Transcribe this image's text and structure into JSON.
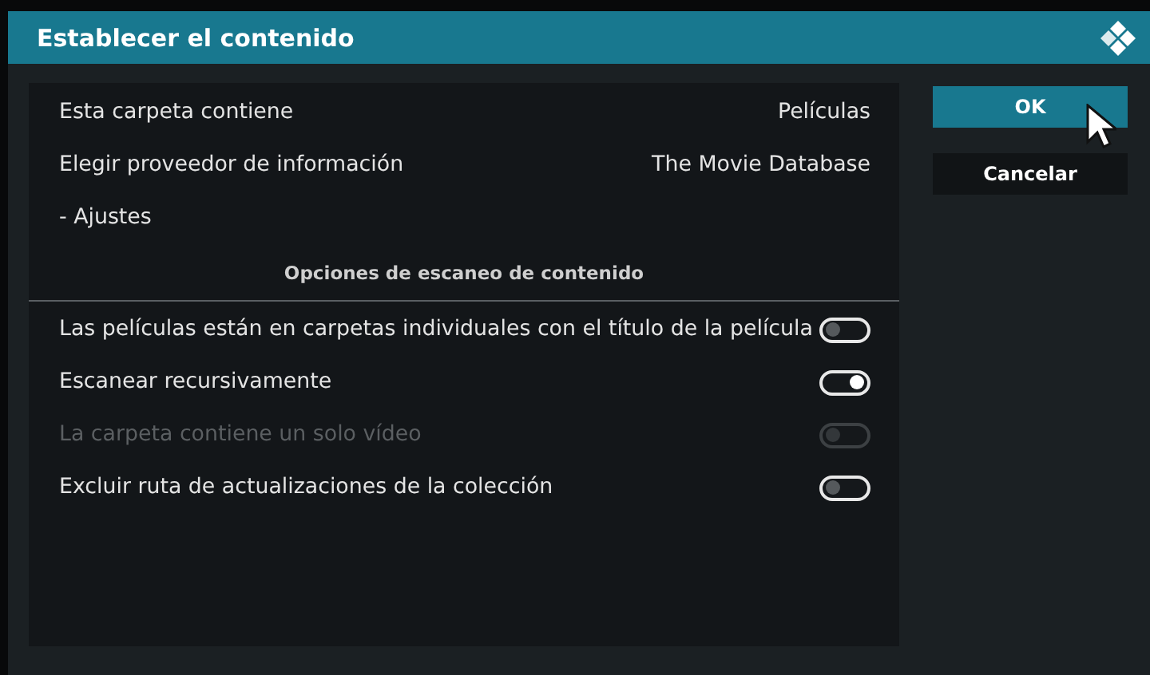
{
  "window": {
    "title": "Establecer el contenido"
  },
  "settings": [
    {
      "kind": "value",
      "label": "Esta carpeta contiene",
      "value": "Películas"
    },
    {
      "kind": "value",
      "label": "Elegir proveedor de información",
      "value": "The Movie Database"
    },
    {
      "kind": "action",
      "label": "- Ajustes"
    },
    {
      "kind": "header",
      "label": "Opciones de escaneo de contenido"
    },
    {
      "kind": "toggle",
      "label": "Las películas están en carpetas individuales con el título de la película",
      "on": false,
      "disabled": false
    },
    {
      "kind": "toggle",
      "label": "Escanear recursivamente",
      "on": true,
      "disabled": false
    },
    {
      "kind": "toggle",
      "label": "La carpeta contiene un solo vídeo",
      "on": false,
      "disabled": true
    },
    {
      "kind": "toggle",
      "label": "Excluir ruta de actualizaciones de la colección",
      "on": false,
      "disabled": false
    }
  ],
  "buttons": [
    {
      "label": "OK",
      "selected": true
    },
    {
      "label": "Cancelar",
      "selected": false
    }
  ]
}
